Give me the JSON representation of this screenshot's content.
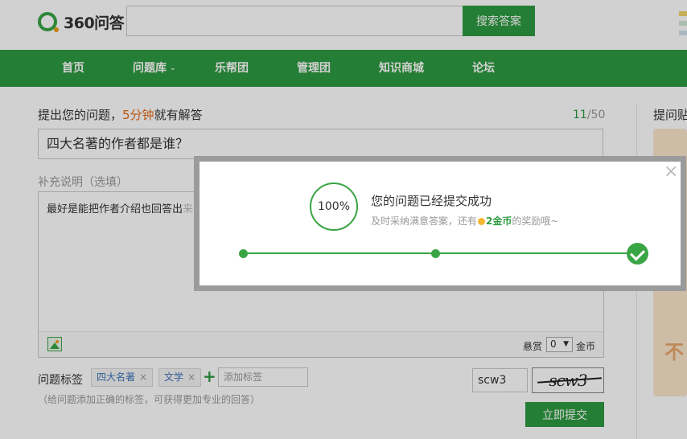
{
  "header": {
    "logo_text": "360问答",
    "search_button": "搜索答案"
  },
  "nav": {
    "items": [
      "首页",
      "问题库",
      "乐帮团",
      "管理团",
      "知识商城",
      "论坛"
    ]
  },
  "ask": {
    "label_prefix": "提出您的问题，",
    "label_highlight": "5分钟",
    "label_suffix": "就有解答",
    "counter_current": "11",
    "counter_total": "/50",
    "question_value": "四大名著的作者都是谁？",
    "supplement_label": "补充说明（选填）",
    "detail_text_visible": "最好是能把作者介绍也回答出",
    "detail_text_faded": "来，谢谢",
    "reward_label": "悬赏",
    "reward_value": "0",
    "coin_label": "金币"
  },
  "tags": {
    "label": "问题标签",
    "items": [
      "四大名著",
      "文学"
    ],
    "remove_glyph": "×",
    "add_glyph": "+",
    "add_placeholder": "添加标签",
    "hint": "（给问题添加正确的标签，可获得更加专业的回答）"
  },
  "captcha": {
    "input_value": "scw3",
    "image_text": "scw3"
  },
  "submit_label": "立即提交",
  "sidebar": {
    "title": "提问贴",
    "ad_text": "不"
  },
  "dialog": {
    "close_glyph": "×",
    "progress": "100%",
    "title": "您的问题已经提交成功",
    "sub_prefix": "及时采纳满意答案，还有",
    "sub_gold": "2金币",
    "sub_suffix": "的奖励哦~"
  },
  "colors": {
    "brand_green": "#2e9a41",
    "highlight_orange": "#e56b17"
  }
}
